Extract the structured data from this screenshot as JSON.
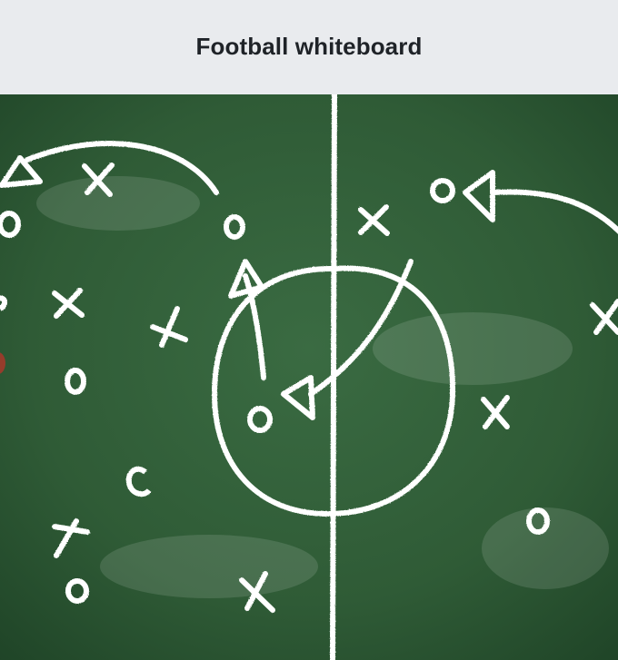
{
  "header": {
    "title": "Football whiteboard"
  },
  "image": {
    "subject": "chalkboard-football-tactics",
    "colors": {
      "board": "#2f5b36",
      "board_dark": "#1f4427",
      "chalk": "#ffffff",
      "header_bg": "#e9ebee",
      "title": "#1f2328",
      "accent_red": "#a23a2a"
    }
  }
}
